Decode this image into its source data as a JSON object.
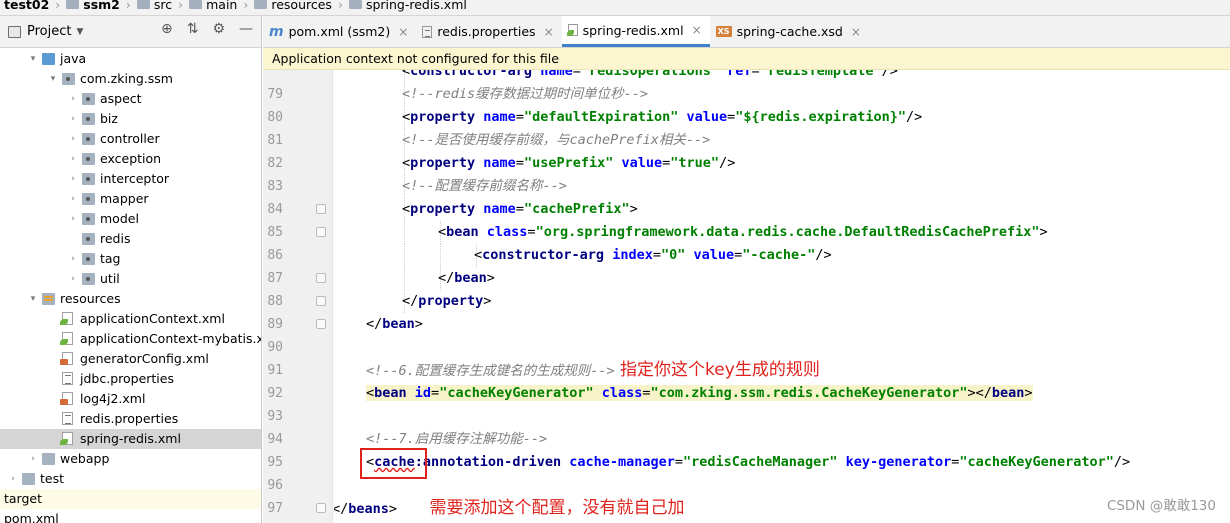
{
  "breadcrumb": {
    "items": [
      "test02",
      "ssm2",
      "src",
      "main",
      "resources",
      "spring-redis.xml"
    ]
  },
  "project_panel": {
    "view_label": "Project",
    "view_dropdown_icon": "chevron-down-icon",
    "tool_icons": [
      "crosshair-icon",
      "collapse-all-icon",
      "gear-icon",
      "minimize-icon"
    ],
    "tree": [
      {
        "label": "java",
        "indent": 1,
        "arrow": "▾",
        "icon": "folder-blue"
      },
      {
        "label": "com.zking.ssm",
        "indent": 2,
        "arrow": "▾",
        "icon": "pkg"
      },
      {
        "label": "aspect",
        "indent": 3,
        "arrow": "›",
        "icon": "pkg"
      },
      {
        "label": "biz",
        "indent": 3,
        "arrow": "›",
        "icon": "pkg"
      },
      {
        "label": "controller",
        "indent": 3,
        "arrow": "›",
        "icon": "pkg"
      },
      {
        "label": "exception",
        "indent": 3,
        "arrow": "›",
        "icon": "pkg"
      },
      {
        "label": "interceptor",
        "indent": 3,
        "arrow": "›",
        "icon": "pkg"
      },
      {
        "label": "mapper",
        "indent": 3,
        "arrow": "›",
        "icon": "pkg"
      },
      {
        "label": "model",
        "indent": 3,
        "arrow": "›",
        "icon": "pkg"
      },
      {
        "label": "redis",
        "indent": 3,
        "arrow": "",
        "icon": "pkg"
      },
      {
        "label": "tag",
        "indent": 3,
        "arrow": "›",
        "icon": "pkg"
      },
      {
        "label": "util",
        "indent": 3,
        "arrow": "›",
        "icon": "pkg"
      },
      {
        "label": "resources",
        "indent": 1,
        "arrow": "▾",
        "icon": "res"
      },
      {
        "label": "applicationContext.xml",
        "indent": 2,
        "arrow": "",
        "icon": "spring"
      },
      {
        "label": "applicationContext-mybatis.xml",
        "indent": 2,
        "arrow": "",
        "icon": "spring"
      },
      {
        "label": "generatorConfig.xml",
        "indent": 2,
        "arrow": "",
        "icon": "xml"
      },
      {
        "label": "jdbc.properties",
        "indent": 2,
        "arrow": "",
        "icon": "props"
      },
      {
        "label": "log4j2.xml",
        "indent": 2,
        "arrow": "",
        "icon": "xml"
      },
      {
        "label": "redis.properties",
        "indent": 2,
        "arrow": "",
        "icon": "props"
      },
      {
        "label": "spring-redis.xml",
        "indent": 2,
        "arrow": "",
        "icon": "spring",
        "selected": true
      },
      {
        "label": "webapp",
        "indent": 1,
        "arrow": "›",
        "icon": "folder"
      },
      {
        "label": "test",
        "indent": 0,
        "arrow": "›",
        "icon": "folder"
      },
      {
        "label": "target",
        "indent": -1,
        "arrow": "",
        "icon": "",
        "highlight": true
      },
      {
        "label": "pom.xml",
        "indent": -1,
        "arrow": "",
        "icon": ""
      }
    ]
  },
  "editor": {
    "tabs": [
      {
        "label": "pom.xml (ssm2)",
        "icon": "m",
        "active": false
      },
      {
        "label": "redis.properties",
        "icon": "p",
        "active": false
      },
      {
        "label": "spring-redis.xml",
        "icon": "s",
        "active": true
      },
      {
        "label": "spring-cache.xsd",
        "icon": "x",
        "active": false
      }
    ],
    "close_glyph": "×",
    "banner": "Application context not configured for this file",
    "lines": [
      {
        "num": "",
        "indent": 2,
        "tokens": [
          [
            "pl",
            "<"
          ],
          [
            "t",
            "constructor-arg "
          ],
          [
            "a",
            "name"
          ],
          [
            "pl",
            "="
          ],
          [
            "v",
            "\"redisOperations\" "
          ],
          [
            "a",
            "ref"
          ],
          [
            "pl",
            "="
          ],
          [
            "v",
            "\"redisTemplate\""
          ],
          [
            "pl",
            "/>"
          ]
        ]
      },
      {
        "num": "79",
        "indent": 2,
        "tokens": [
          [
            "c",
            "<!--redis缓存数据过期时间单位秒-->"
          ]
        ]
      },
      {
        "num": "80",
        "indent": 2,
        "tokens": [
          [
            "pl",
            "<"
          ],
          [
            "t",
            "property "
          ],
          [
            "a",
            "name"
          ],
          [
            "pl",
            "="
          ],
          [
            "v",
            "\"defaultExpiration\" "
          ],
          [
            "a",
            "value"
          ],
          [
            "pl",
            "="
          ],
          [
            "v",
            "\"${redis.expiration}\""
          ],
          [
            "pl",
            "/>"
          ]
        ]
      },
      {
        "num": "81",
        "indent": 2,
        "tokens": [
          [
            "c",
            "<!--是否使用缓存前缀，与cachePrefix相关-->"
          ]
        ]
      },
      {
        "num": "82",
        "indent": 2,
        "tokens": [
          [
            "pl",
            "<"
          ],
          [
            "t",
            "property "
          ],
          [
            "a",
            "name"
          ],
          [
            "pl",
            "="
          ],
          [
            "v",
            "\"usePrefix\" "
          ],
          [
            "a",
            "value"
          ],
          [
            "pl",
            "="
          ],
          [
            "v",
            "\"true\""
          ],
          [
            "pl",
            "/>"
          ]
        ]
      },
      {
        "num": "83",
        "indent": 2,
        "tokens": [
          [
            "c",
            "<!--配置缓存前缀名称-->"
          ]
        ]
      },
      {
        "num": "84",
        "indent": 2,
        "fold": true,
        "tokens": [
          [
            "pl",
            "<"
          ],
          [
            "t",
            "property "
          ],
          [
            "a",
            "name"
          ],
          [
            "pl",
            "="
          ],
          [
            "v",
            "\"cachePrefix\""
          ],
          [
            "pl",
            ">"
          ]
        ]
      },
      {
        "num": "85",
        "indent": 3,
        "fold": true,
        "tokens": [
          [
            "pl",
            "<"
          ],
          [
            "t",
            "bean "
          ],
          [
            "a",
            "class"
          ],
          [
            "pl",
            "="
          ],
          [
            "v",
            "\"org.springframework.data.redis.cache.DefaultRedisCachePrefix\""
          ],
          [
            "pl",
            ">"
          ]
        ]
      },
      {
        "num": "86",
        "indent": 4,
        "tokens": [
          [
            "pl",
            "<"
          ],
          [
            "t",
            "constructor-arg "
          ],
          [
            "a",
            "index"
          ],
          [
            "pl",
            "="
          ],
          [
            "v",
            "\"0\" "
          ],
          [
            "a",
            "value"
          ],
          [
            "pl",
            "="
          ],
          [
            "v",
            "\"-cache-\""
          ],
          [
            "pl",
            "/>"
          ]
        ]
      },
      {
        "num": "87",
        "indent": 3,
        "fold": true,
        "tokens": [
          [
            "pl",
            "</"
          ],
          [
            "t",
            "bean"
          ],
          [
            "pl",
            ">"
          ]
        ]
      },
      {
        "num": "88",
        "indent": 2,
        "fold": true,
        "tokens": [
          [
            "pl",
            "</"
          ],
          [
            "t",
            "property"
          ],
          [
            "pl",
            ">"
          ]
        ]
      },
      {
        "num": "89",
        "indent": 1,
        "fold": true,
        "tokens": [
          [
            "pl",
            "</"
          ],
          [
            "t",
            "bean"
          ],
          [
            "pl",
            ">"
          ]
        ]
      },
      {
        "num": "90",
        "indent": 0,
        "tokens": []
      },
      {
        "num": "91",
        "indent": 1,
        "tokens": [
          [
            "c",
            "<!--6.配置缓存生成键名的生成规则-->"
          ],
          [
            "note",
            " 指定你这个key生成的规则"
          ]
        ]
      },
      {
        "num": "92",
        "indent": 1,
        "mark": true,
        "tokens": [
          [
            "pl",
            "<"
          ],
          [
            "t",
            "bean "
          ],
          [
            "a",
            "id"
          ],
          [
            "pl",
            "="
          ],
          [
            "v",
            "\"cacheKeyGenerator\" "
          ],
          [
            "a",
            "class"
          ],
          [
            "pl",
            "="
          ],
          [
            "v",
            "\"com.zking.ssm.redis.CacheKeyGenerator\""
          ],
          [
            "pl",
            "></"
          ],
          [
            "t",
            "bean"
          ],
          [
            "pl",
            ">"
          ]
        ]
      },
      {
        "num": "93",
        "indent": 0,
        "tokens": []
      },
      {
        "num": "94",
        "indent": 1,
        "tokens": [
          [
            "c",
            "<!--7.启用缓存注解功能-->"
          ]
        ]
      },
      {
        "num": "95",
        "indent": 1,
        "tokens": [
          [
            "pl",
            "<"
          ],
          [
            "w",
            "cache"
          ],
          [
            "t",
            ":annotation-driven "
          ],
          [
            "a",
            "cache-manager"
          ],
          [
            "pl",
            "="
          ],
          [
            "v",
            "\"redisCacheManager\" "
          ],
          [
            "a",
            "key-generator"
          ],
          [
            "pl",
            "="
          ],
          [
            "v",
            "\"cacheKeyGenerator\""
          ],
          [
            "pl",
            "/>"
          ]
        ]
      },
      {
        "num": "96",
        "indent": 0,
        "tokens": []
      },
      {
        "num": "97",
        "indent": 0,
        "fold": true,
        "tokens": [
          [
            "pl",
            "</"
          ],
          [
            "t",
            "beans"
          ],
          [
            "pl",
            ">"
          ],
          [
            "note",
            "      需要添加这个配置，没有就自己加"
          ]
        ]
      }
    ]
  },
  "watermark": "CSDN @敢敢130"
}
